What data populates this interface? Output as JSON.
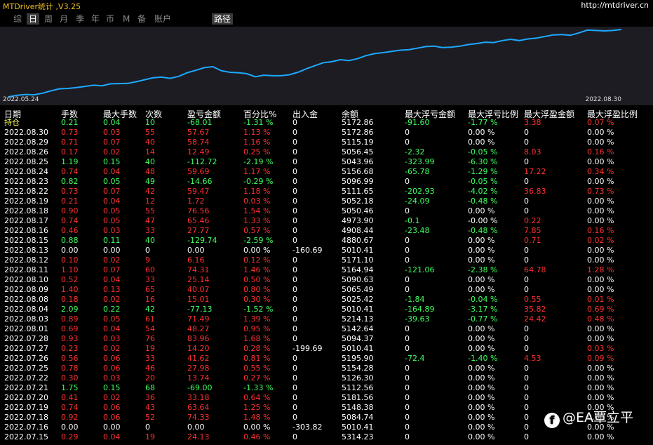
{
  "app": {
    "title": "MTDriver统计 ,V3.25",
    "url": "http://mtdriver.cn"
  },
  "tabs": [
    "综",
    "日",
    "周",
    "月",
    "季",
    "年",
    "币",
    "M",
    "备",
    "账户",
    "路径"
  ],
  "active_tabs": [
    "日",
    "路径"
  ],
  "chart": {
    "start_label": "2022.05.24",
    "end_label": "2022.08.30",
    "line_color": "#1ea8ff",
    "balance_path": [
      4840,
      4848,
      4852,
      4850,
      4858,
      4870,
      4880,
      4882,
      4886,
      4892,
      4898,
      4895,
      4905,
      4906,
      4907,
      4915,
      4925,
      4935,
      4938,
      4932,
      4942,
      4960,
      4972,
      4985,
      4990,
      4970,
      4962,
      4960,
      4955,
      4940,
      4948,
      4945,
      4945,
      4950,
      4962,
      4980,
      4995,
      5010,
      5015,
      5025,
      5020,
      5030,
      5045,
      5055,
      5060,
      5066,
      5072,
      5074,
      5082,
      5090,
      5092,
      5085,
      5087,
      5092,
      5100,
      5105,
      5112,
      5110,
      5120,
      5126,
      5120,
      5128,
      5132,
      5140,
      5148,
      5150,
      5146,
      5158,
      5172,
      5170,
      5168,
      5170,
      5175
    ]
  },
  "headers": [
    "日期",
    "手数",
    "最大手数",
    "次数",
    "盈亏金额",
    "百分比%",
    "出入金",
    "余额",
    "最大浮亏金额",
    "最大浮亏比例",
    "最大浮盈金额",
    "最大浮盈比例"
  ],
  "rows": [
    [
      "持仓",
      "0.21",
      "0.04",
      "10",
      "-68.01",
      "-1.31 %",
      "0",
      "5172.86",
      "-91.60",
      "-1.77 %",
      "3.38",
      "0.07 %"
    ],
    [
      "2022.08.30",
      "0.73",
      "0.03",
      "55",
      "57.67",
      "1.13 %",
      "0",
      "5172.86",
      "0",
      "0.00 %",
      "0",
      "0.00 %"
    ],
    [
      "2022.08.29",
      "0.71",
      "0.07",
      "40",
      "58.74",
      "1.16 %",
      "0",
      "5115.19",
      "0",
      "0.00 %",
      "0",
      "0.00 %"
    ],
    [
      "2022.08.26",
      "0.17",
      "0.02",
      "14",
      "12.49",
      "0.25 %",
      "0",
      "5056.45",
      "-2.32",
      "-0.05 %",
      "8.03",
      "0.16 %"
    ],
    [
      "2022.08.25",
      "1.19",
      "0.15",
      "40",
      "-112.72",
      "-2.19 %",
      "0",
      "5043.96",
      "-323.99",
      "-6.30 %",
      "0",
      "0.00 %"
    ],
    [
      "2022.08.24",
      "0.74",
      "0.04",
      "48",
      "59.69",
      "1.17 %",
      "0",
      "5156.68",
      "-65.78",
      "-1.29 %",
      "17.22",
      "0.34 %"
    ],
    [
      "2022.08.23",
      "0.82",
      "0.05",
      "49",
      "-14.66",
      "-0.29 %",
      "0",
      "5096.99",
      "0",
      "-0.05 %",
      "0",
      "0.00 %"
    ],
    [
      "2022.08.22",
      "0.73",
      "0.07",
      "42",
      "59.47",
      "1.18 %",
      "0",
      "5111.65",
      "-202.93",
      "-4.02 %",
      "36.83",
      "0.73 %"
    ],
    [
      "2022.08.19",
      "0.21",
      "0.04",
      "12",
      "1.72",
      "0.03 %",
      "0",
      "5052.18",
      "-24.09",
      "-0.48 %",
      "0",
      "0.00 %"
    ],
    [
      "2022.08.18",
      "0.90",
      "0.05",
      "55",
      "76.56",
      "1.54 %",
      "0",
      "5050.46",
      "0",
      "0.00 %",
      "0",
      "0.00 %"
    ],
    [
      "2022.08.17",
      "0.74",
      "0.05",
      "47",
      "65.46",
      "1.33 %",
      "0",
      "4973.90",
      "-0.1",
      "-0.00 %",
      "0.22",
      "0.00 %"
    ],
    [
      "2022.08.16",
      "0.46",
      "0.03",
      "33",
      "27.77",
      "0.57 %",
      "0",
      "4908.44",
      "-23.48",
      "-0.48 %",
      "7.85",
      "0.16 %"
    ],
    [
      "2022.08.15",
      "0.88",
      "0.11",
      "40",
      "-129.74",
      "-2.59 %",
      "0",
      "4880.67",
      "0",
      "0.00 %",
      "0.71",
      "0.02 %"
    ],
    [
      "2022.08.13",
      "0.00",
      "0.00",
      "0",
      "0.00",
      "0.00 %",
      "-160.69",
      "5010.41",
      "0",
      "0.00 %",
      "0",
      "0.00 %"
    ],
    [
      "2022.08.12",
      "0.10",
      "0.02",
      "9",
      "6.16",
      "0.12 %",
      "0",
      "5171.10",
      "0",
      "0.00 %",
      "0",
      "0.00 %"
    ],
    [
      "2022.08.11",
      "1.10",
      "0.07",
      "60",
      "74.31",
      "1.46 %",
      "0",
      "5164.94",
      "-121.06",
      "-2.38 %",
      "64.78",
      "1.28 %"
    ],
    [
      "2022.08.10",
      "0.52",
      "0.04",
      "33",
      "25.14",
      "0.50 %",
      "0",
      "5090.63",
      "0",
      "0.00 %",
      "0",
      "0.00 %"
    ],
    [
      "2022.08.09",
      "1.40",
      "0.13",
      "65",
      "40.07",
      "0.80 %",
      "0",
      "5065.49",
      "0",
      "0.00 %",
      "0",
      "0.00 %"
    ],
    [
      "2022.08.08",
      "0.18",
      "0.02",
      "16",
      "15.01",
      "0.30 %",
      "0",
      "5025.42",
      "-1.84",
      "-0.04 %",
      "0.55",
      "0.01 %"
    ],
    [
      "2022.08.04",
      "2.09",
      "0.22",
      "42",
      "-77.13",
      "-1.52 %",
      "0",
      "5010.41",
      "-164.89",
      "-3.17 %",
      "35.82",
      "0.69 %"
    ],
    [
      "2022.08.03",
      "0.89",
      "0.05",
      "61",
      "71.49",
      "1.39 %",
      "0",
      "5214.13",
      "-39.63",
      "-0.77 %",
      "24.42",
      "0.48 %"
    ],
    [
      "2022.08.01",
      "0.69",
      "0.04",
      "54",
      "48.27",
      "0.95 %",
      "0",
      "5142.64",
      "0",
      "0.00 %",
      "0",
      "0.00 %"
    ],
    [
      "2022.07.28",
      "0.93",
      "0.03",
      "76",
      "83.96",
      "1.68 %",
      "0",
      "5094.37",
      "0",
      "0.00 %",
      "0",
      "0.00 %"
    ],
    [
      "2022.07.27",
      "0.23",
      "0.02",
      "19",
      "14.20",
      "0.28 %",
      "-199.69",
      "5010.41",
      "0",
      "0.00 %",
      "0",
      "0.03 %"
    ],
    [
      "2022.07.26",
      "0.56",
      "0.06",
      "33",
      "41.62",
      "0.81 %",
      "0",
      "5195.90",
      "-72.4",
      "-1.40 %",
      "4.53",
      "0.09 %"
    ],
    [
      "2022.07.25",
      "0.78",
      "0.06",
      "46",
      "27.98",
      "0.55 %",
      "0",
      "5154.28",
      "0",
      "0.00 %",
      "0",
      "0.00 %"
    ],
    [
      "2022.07.22",
      "0.30",
      "0.03",
      "20",
      "13.74",
      "0.27 %",
      "0",
      "5126.30",
      "0",
      "0.00 %",
      "0",
      "0.00 %"
    ],
    [
      "2022.07.21",
      "1.75",
      "0.15",
      "68",
      "-69.00",
      "-1.33 %",
      "0",
      "5112.56",
      "0",
      "0.00 %",
      "0",
      "0.00 %"
    ],
    [
      "2022.07.20",
      "0.41",
      "0.02",
      "36",
      "33.18",
      "0.64 %",
      "0",
      "5181.56",
      "0",
      "0.00 %",
      "0",
      "0.00 %"
    ],
    [
      "2022.07.19",
      "0.74",
      "0.06",
      "43",
      "63.64",
      "1.25 %",
      "0",
      "5148.38",
      "0",
      "0.00 %",
      "0",
      "0.00 %"
    ],
    [
      "2022.07.18",
      "0.92",
      "0.06",
      "52",
      "74.33",
      "1.48 %",
      "0",
      "5084.74",
      "0",
      "0.00 %",
      "0",
      "0.00 %"
    ],
    [
      "2022.07.16",
      "0.00",
      "0.00",
      "0",
      "0.00",
      "0.00 %",
      "-303.82",
      "5010.41",
      "0",
      "0.00 %",
      "0",
      "0.00 %"
    ],
    [
      "2022.07.15",
      "0.29",
      "0.04",
      "19",
      "24.13",
      "0.46 %",
      "0",
      "5314.23",
      "0",
      "0.00 %",
      "0",
      "0.00 %"
    ]
  ],
  "watermark": {
    "icon": "facebook-icon",
    "text": "@EA覃立平"
  }
}
